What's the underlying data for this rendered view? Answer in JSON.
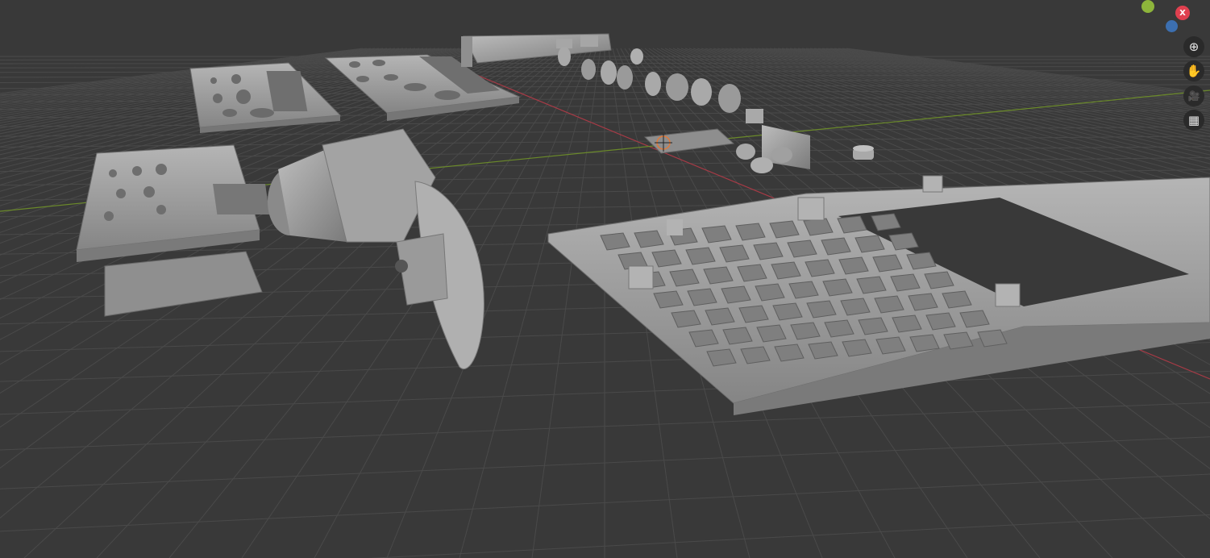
{
  "viewport": {
    "background": "#393939",
    "grid_color": "#4a4a4a",
    "x_axis_color": "#a83a46",
    "y_axis_color": "#6b8a2a"
  },
  "gizmo": {
    "y_axis": {
      "color": "#8db43b"
    },
    "x_axis": {
      "label": "X",
      "color": "#e0404f"
    },
    "z_axis": {
      "color": "#3c6fb0"
    }
  },
  "navigation": [
    {
      "name": "zoom-icon",
      "glyph": "⊕"
    },
    {
      "name": "hand-pan-icon",
      "glyph": "✋"
    },
    {
      "name": "camera-view-icon",
      "glyph": "🎥"
    },
    {
      "name": "perspective-grid-icon",
      "glyph": "▦"
    }
  ],
  "model": {
    "mesh_color": "#9d9d9d",
    "parts": [
      "top-plate-a",
      "top-plate-b",
      "side-rail",
      "knob-cluster",
      "circuit-board",
      "button-cap",
      "base-plate-stack",
      "grip-housing",
      "grid-tray"
    ]
  }
}
